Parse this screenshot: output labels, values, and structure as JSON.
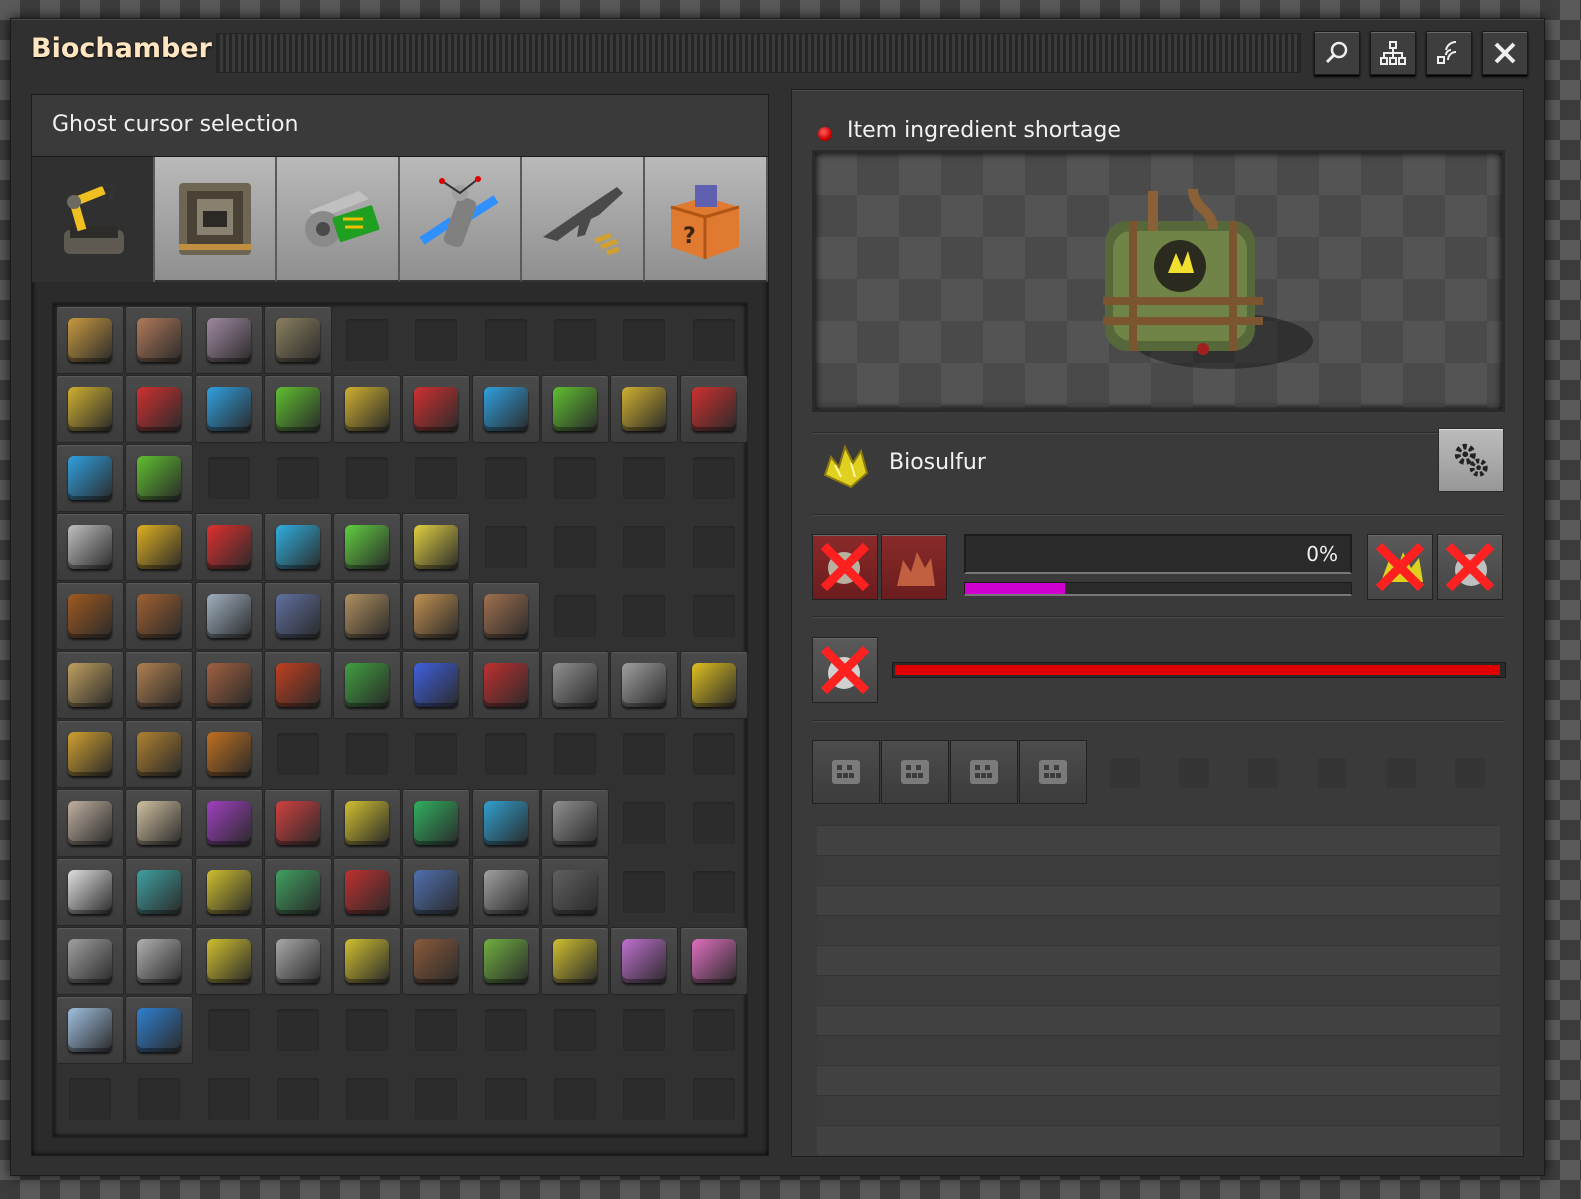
{
  "window": {
    "title": "Biochamber"
  },
  "titlebar_buttons": [
    {
      "name": "search-button",
      "icon": "magnifier-icon"
    },
    {
      "name": "tech-tree-button",
      "icon": "hierarchy-icon"
    },
    {
      "name": "wireless-button",
      "icon": "signal-icon"
    },
    {
      "name": "close-button",
      "icon": "close-icon"
    }
  ],
  "left": {
    "header": "Ghost cursor selection",
    "tabs": [
      {
        "name": "logistics",
        "icon": "inserter-icon",
        "active": true
      },
      {
        "name": "production",
        "icon": "assembler-icon"
      },
      {
        "name": "intermediate-products",
        "icon": "gear-circuit-icon"
      },
      {
        "name": "space",
        "icon": "satellite-icon"
      },
      {
        "name": "combat",
        "icon": "rifle-icon"
      },
      {
        "name": "unsorted",
        "icon": "mystery-box-icon"
      }
    ]
  },
  "right": {
    "status": {
      "text": "Item ingredient shortage",
      "color": "#e00000"
    },
    "recipe": {
      "name": "Biosulfur"
    },
    "progress": {
      "text": "0%",
      "sub_fraction": 0.26
    },
    "energy_fraction": 0.995
  },
  "colors": {
    "window_bg": "#313031",
    "title_text": "#ffe6c0",
    "progress_fill": "#d000d0",
    "energy_fill": "#e00000"
  }
}
